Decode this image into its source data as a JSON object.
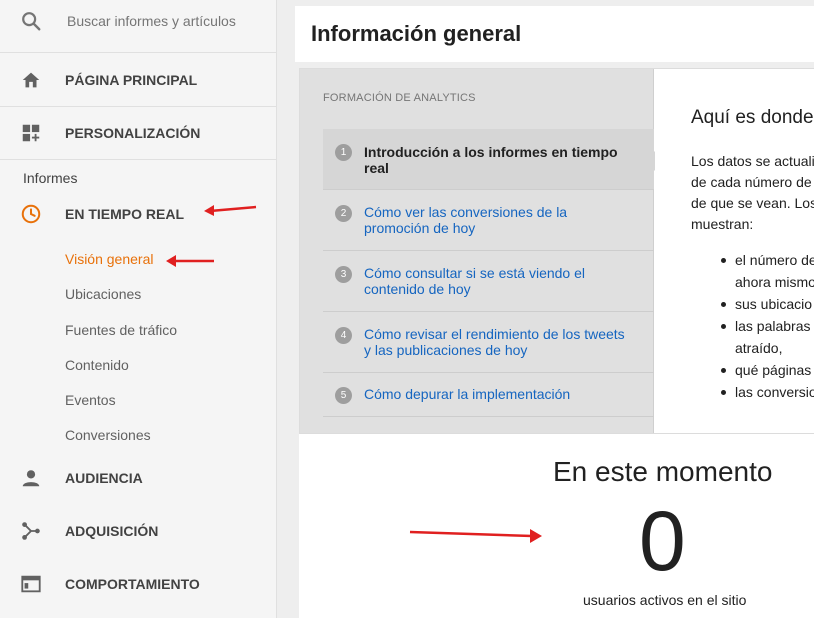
{
  "sidebar": {
    "search_placeholder": "Buscar informes y artículos",
    "items": [
      {
        "label": "PÁGINA PRINCIPAL",
        "icon": "home-icon"
      },
      {
        "label": "PERSONALIZACIÓN",
        "icon": "dashboard-plus-icon"
      }
    ],
    "section_heading": "Informes",
    "realtime": {
      "label": "EN TIEMPO REAL",
      "icon": "clock-icon",
      "sub_items": [
        {
          "label": "Visión general",
          "active": true
        },
        {
          "label": "Ubicaciones"
        },
        {
          "label": "Fuentes de tráfico"
        },
        {
          "label": "Contenido"
        },
        {
          "label": "Eventos"
        },
        {
          "label": "Conversiones"
        }
      ]
    },
    "bottom_items": [
      {
        "label": "AUDIENCIA",
        "icon": "person-icon"
      },
      {
        "label": "ADQUISICIÓN",
        "icon": "acquisition-icon"
      },
      {
        "label": "COMPORTAMIENTO",
        "icon": "behavior-window-icon"
      }
    ]
  },
  "main": {
    "title": "Información general",
    "training": {
      "heading": "FORMACIÓN DE ANALYTICS",
      "lessons": [
        {
          "num": "1",
          "text": "Introducción a los informes en tiempo real"
        },
        {
          "num": "2",
          "text": "Cómo ver las conversiones de la promoción de hoy"
        },
        {
          "num": "3",
          "text": "Cómo consultar si se está viendo el contenido de hoy"
        },
        {
          "num": "4",
          "text": "Cómo revisar el rendimiento de los tweets y las publicaciones de hoy"
        },
        {
          "num": "5",
          "text": "Cómo depurar la implementación"
        }
      ],
      "detail_title": "Aquí es donde",
      "detail_lines": [
        "Los datos se actuali",
        "de cada número de",
        "de que se vean. Los",
        "muestran:"
      ],
      "bullets": [
        {
          "line1": "el número de",
          "line2": "ahora mismo"
        },
        {
          "line1": "sus ubicacio"
        },
        {
          "line1": "las palabras",
          "line2": "atraído,"
        },
        {
          "line1": "qué páginas"
        },
        {
          "line1": "las conversio"
        }
      ]
    },
    "realtime": {
      "title": "En este momento",
      "active_users": "0",
      "caption": "usuarios activos en el sitio"
    }
  },
  "colors": {
    "accent": "#e8710a",
    "link": "#1565c0",
    "arrow": "#e02020"
  }
}
